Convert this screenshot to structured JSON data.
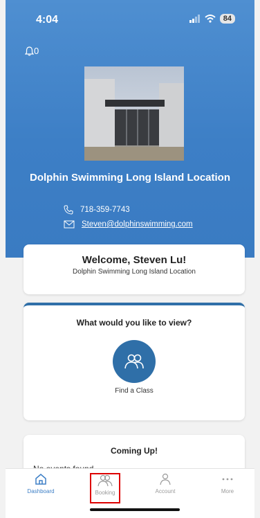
{
  "status": {
    "time": "4:04",
    "battery": "84"
  },
  "notifications": {
    "count": "0"
  },
  "location": {
    "name": "Dolphin Swimming Long Island Location",
    "phone": "718-359-7743",
    "email": "Steven@dolphinswimming.com"
  },
  "welcome": {
    "title": "Welcome, Steven Lu!",
    "subtitle": "Dolphin Swimming Long Island Location"
  },
  "view": {
    "question": "What would you like to view?",
    "find_label": "Find a Class"
  },
  "coming": {
    "title": "Coming Up!",
    "empty": "No events found"
  },
  "tabs": [
    {
      "label": "Dashboard",
      "icon": "home-icon"
    },
    {
      "label": "Booking",
      "icon": "users-icon"
    },
    {
      "label": "Account",
      "icon": "user-icon"
    },
    {
      "label": "More",
      "icon": "more-icon"
    }
  ],
  "colors": {
    "hero": "#3d7fc6",
    "accent": "#2f6fa8",
    "highlight": "#d00000"
  }
}
